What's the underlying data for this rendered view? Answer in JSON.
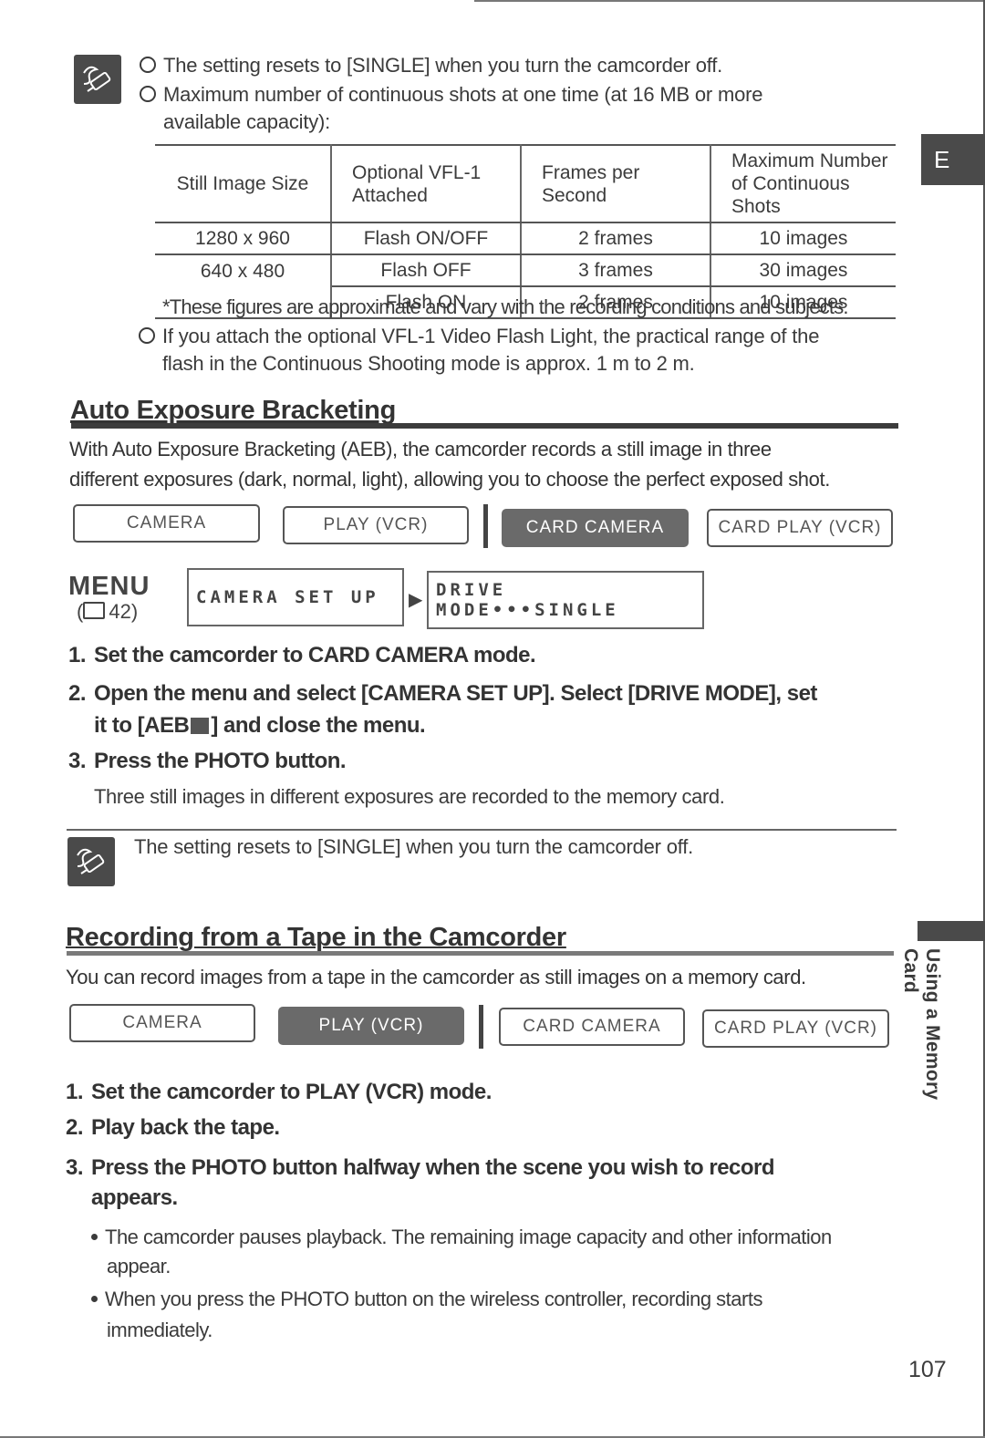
{
  "page": {
    "number": "107",
    "language_tab": "E",
    "side_label": "Using a Memory Card"
  },
  "continuous_notes": {
    "icon": "pencil-note-icon",
    "items": [
      "The setting resets to [SINGLE] when you turn the camcorder off.",
      "Maximum number of continuous shots at one time (at 16 MB or more",
      "available capacity):"
    ]
  },
  "shots_table": {
    "headers": [
      "Still Image Size",
      "Optional VFL-1 Attached",
      "Frames per Second",
      "Maximum Number of Continuous Shots"
    ],
    "header_lines": {
      "h2a": "Optional VFL-1",
      "h2b": "Attached",
      "h3a": "Frames per",
      "h3b": "Second",
      "h4a": "Maximum Number",
      "h4b": "of Continuous Shots"
    },
    "rows": [
      {
        "size": "1280 x 960",
        "flash": "Flash ON/OFF",
        "fps": "2 frames",
        "max": "10 images"
      },
      {
        "size": "640 x 480",
        "flash": "Flash OFF",
        "fps": "3 frames",
        "max": "30 images"
      },
      {
        "size": "",
        "flash": "Flash ON",
        "fps": "2 frames",
        "max": "10 images"
      }
    ],
    "footnote": "*These figures are approximate and vary with the recording conditions and subjects."
  },
  "flash_note": {
    "line1": "If you attach the optional VFL-1 Video Flash Light, the practical range of the",
    "line2": "flash in the Continuous Shooting mode is approx. 1 m to 2 m."
  },
  "aeb_section": {
    "title": "Auto Exposure Bracketing",
    "intro_line1": "With Auto Exposure Bracketing (AEB), the camcorder records a still image in three",
    "intro_line2": "different exposures (dark, normal, light), allowing you to choose the perfect exposed shot.",
    "modes": [
      {
        "label": "CAMERA",
        "active": false
      },
      {
        "label": "PLAY (VCR)",
        "active": false
      },
      {
        "label": "CARD CAMERA",
        "active": true
      },
      {
        "label": "CARD PLAY (VCR)",
        "active": false
      }
    ],
    "menu": {
      "label": "MENU",
      "ref": "(🕮 42)",
      "ref_page": "42",
      "box1": "CAMERA SET UP",
      "arrow": "▶",
      "box2": "DRIVE MODE•••SINGLE"
    },
    "steps": [
      {
        "num": "1.",
        "text": "Set the camcorder to CARD CAMERA mode."
      },
      {
        "num": "2.",
        "text": "Open the menu and select [CAMERA SET UP]. Select [DRIVE MODE], set",
        "cont_pre": "it to [AEB",
        "cont_post": "] and close the menu."
      },
      {
        "num": "3.",
        "text": "Press the PHOTO button."
      }
    ],
    "step3_desc": "Three still images in different exposures are recorded to the memory card.",
    "note": "The setting resets to [SINGLE] when you turn the camcorder off."
  },
  "tape_section": {
    "title": "Recording from a Tape in the Camcorder",
    "intro": "You can record images from a tape in the camcorder as still images on a memory card.",
    "modes": [
      {
        "label": "CAMERA",
        "active": false
      },
      {
        "label": "PLAY (VCR)",
        "active": true
      },
      {
        "label": "CARD CAMERA",
        "active": false
      },
      {
        "label": "CARD PLAY (VCR)",
        "active": false
      }
    ],
    "steps": [
      {
        "num": "1.",
        "text": "Set the camcorder to PLAY (VCR) mode."
      },
      {
        "num": "2.",
        "text": "Play back the tape."
      },
      {
        "num": "3.",
        "text": "Press the PHOTO button halfway when the scene you wish to record",
        "cont": "appears."
      }
    ],
    "bullets": [
      {
        "line1": "The camcorder pauses playback. The remaining image capacity and other information",
        "line2": "appear."
      },
      {
        "line1": "When you press the PHOTO button on the wireless controller, recording starts",
        "line2": "immediately."
      }
    ]
  }
}
